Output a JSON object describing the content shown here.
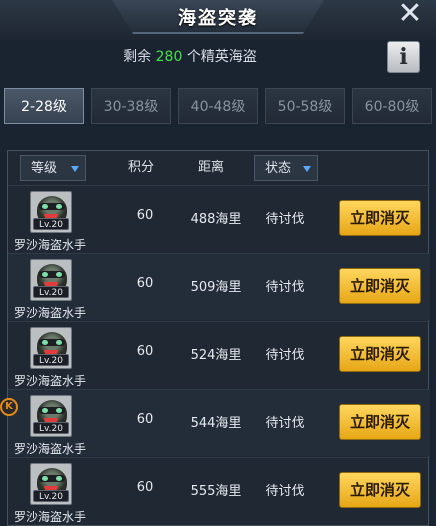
{
  "header": {
    "title": "海盗突袭"
  },
  "summary": {
    "prefix": "剩余",
    "count": "280",
    "suffix": "个精英海盗"
  },
  "info_label": "i",
  "tabs": [
    {
      "label": "2-28级",
      "active": true
    },
    {
      "label": "30-38级",
      "active": false
    },
    {
      "label": "40-48级",
      "active": false
    },
    {
      "label": "50-58级",
      "active": false
    },
    {
      "label": "60-80级",
      "active": false
    }
  ],
  "table": {
    "headers": {
      "level": "等级",
      "score": "积分",
      "distance": "距离",
      "status": "状态"
    },
    "rows": [
      {
        "level": "Lv.20",
        "name": "罗沙海盗水手",
        "score": "60",
        "distance": "488海里",
        "status": "待讨伐",
        "action": "立即消灭"
      },
      {
        "level": "Lv.20",
        "name": "罗沙海盗水手",
        "score": "60",
        "distance": "509海里",
        "status": "待讨伐",
        "action": "立即消灭"
      },
      {
        "level": "Lv.20",
        "name": "罗沙海盗水手",
        "score": "60",
        "distance": "524海里",
        "status": "待讨伐",
        "action": "立即消灭"
      },
      {
        "level": "Lv.20",
        "name": "罗沙海盗水手",
        "score": "60",
        "distance": "544海里",
        "status": "待讨伐",
        "action": "立即消灭"
      },
      {
        "level": "Lv.20",
        "name": "罗沙海盗水手",
        "score": "60",
        "distance": "555海里",
        "status": "待讨伐",
        "action": "立即消灭"
      }
    ]
  },
  "side_marker": "K",
  "colors": {
    "accent_green": "#46e04a",
    "button_gold": "#f3be33",
    "sort_blue": "#5da7ff"
  }
}
